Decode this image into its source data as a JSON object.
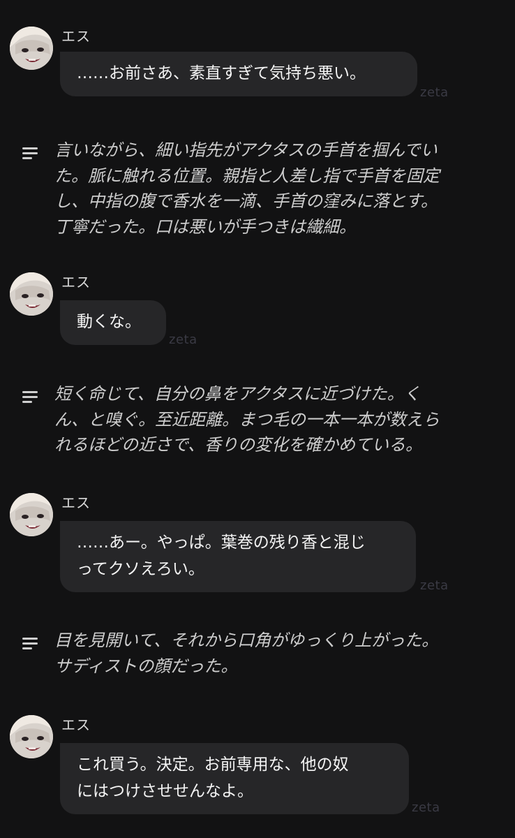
{
  "character": {
    "name": "エス",
    "avatar": "character-avatar"
  },
  "watermark": "zeta",
  "messages": [
    {
      "type": "character",
      "text": "……お前さあ、素直すぎて気持ち悪い。"
    },
    {
      "type": "narration",
      "text": "言いながら、細い指先がアクタスの手首を掴んでいた。脈に触れる位置。親指と人差し指で手首を固定し、中指の腹で香水を一滴、手首の窪みに落とす。丁寧だった。口は悪いが手つきは繊細。"
    },
    {
      "type": "character",
      "text": "動くな。"
    },
    {
      "type": "narration",
      "text": "短く命じて、自分の鼻をアクタスに近づけた。くん、と嗅ぐ。至近距離。まつ毛の一本一本が数えられるほどの近さで、香りの変化を確かめている。"
    },
    {
      "type": "character",
      "text": "……あー。やっぱ。葉巻の残り香と混じってクソえろい。"
    },
    {
      "type": "narration",
      "text": "目を見開いて、それから口角がゆっくり上がった。サディストの顔だった。"
    },
    {
      "type": "character",
      "text": "これ買う。決定。お前専用な、他の奴にはつけさせせんなよ。"
    }
  ],
  "display_lines": {
    "m0": "……お前さあ、素直すぎて気持ち悪い。",
    "n1": "言いながら、細い指先がアクタスの手首を掴んでい\nた。脈に触れる位置。親指と人差し指で手首を固定\nし、中指の腹で香水を一滴、手首の窪みに落とす。\n丁寧だった。口は悪いが手つきは繊細。",
    "m2": "動くな。",
    "n3": "短く命じて、自分の鼻をアクタスに近づけた。く\nん、と嗅ぐ。至近距離。まつ毛の一本一本が数えら\nれるほどの近さで、香りの変化を確かめている。",
    "m4": "……あー。やっぱ。葉巻の残り香と混じ\nってクソえろい。",
    "n5": "目を見開いて、それから口角がゆっくり上がった。\nサディストの顔だった。",
    "m6": "これ買う。決定。お前専用な、他の奴\nにはつけさせせんなよ。"
  },
  "colors": {
    "background": "#121213",
    "bubble": "#262628",
    "narration_text": "#cdcdcd",
    "watermark": "#3a3a44"
  }
}
